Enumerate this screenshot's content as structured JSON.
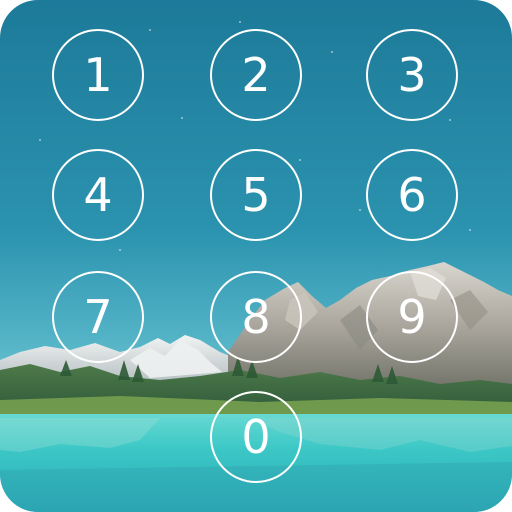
{
  "colors": {
    "sky_top": "#1f7e9c",
    "sky_bottom": "#58b7c9",
    "water": "#3fd0cb",
    "key_stroke": "#ffffff"
  },
  "keypad": {
    "keys": [
      {
        "name": "key-1",
        "label": "1"
      },
      {
        "name": "key-2",
        "label": "2"
      },
      {
        "name": "key-3",
        "label": "3"
      },
      {
        "name": "key-4",
        "label": "4"
      },
      {
        "name": "key-5",
        "label": "5"
      },
      {
        "name": "key-6",
        "label": "6"
      },
      {
        "name": "key-7",
        "label": "7"
      },
      {
        "name": "key-8",
        "label": "8"
      },
      {
        "name": "key-9",
        "label": "9"
      },
      {
        "name": "key-0",
        "label": "0"
      }
    ]
  }
}
